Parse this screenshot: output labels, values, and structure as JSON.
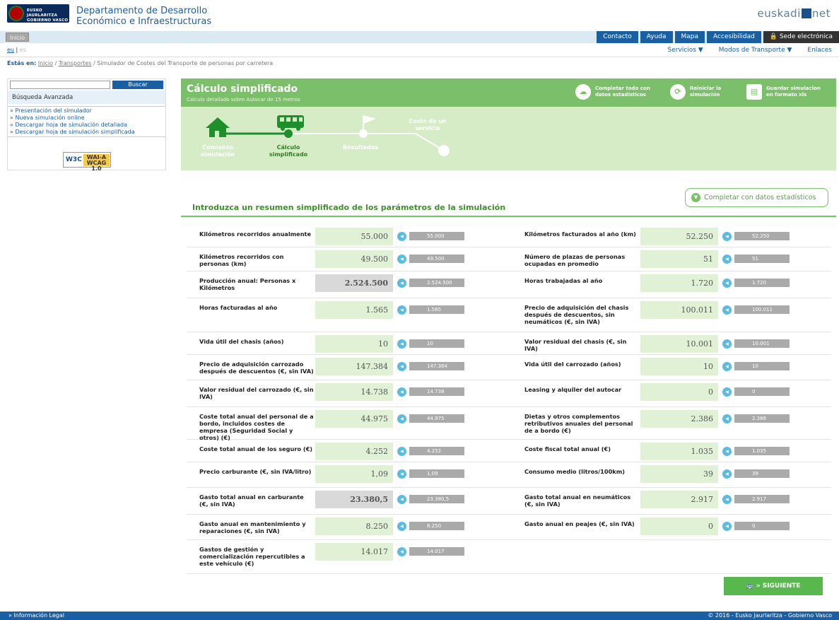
{
  "header": {
    "logo_text": "EUSKO JAURLARITZA GOBIERNO VASCO",
    "dept_line1": "Departamento de Desarrollo",
    "dept_line2": "Económico e Infraestructuras",
    "brand": "euskadi",
    "brand_suffix": "net"
  },
  "navbar": {
    "inicio": "Inicio",
    "buttons": [
      "Contacto",
      "Ayuda",
      "Mapa",
      "Accesibilidad",
      "Sede electrónica"
    ]
  },
  "lang": {
    "eu": "eu",
    "es": "es"
  },
  "menus": [
    "Servicios ▼",
    "Modos de Transporte ▼",
    "Enlaces"
  ],
  "breadcrumb": {
    "label": "Estás en:",
    "items": [
      "Inicio",
      "Transportes"
    ],
    "current": "Simulador de Costes del Transporte de personas por carretera"
  },
  "sidebar": {
    "search_button": "Buscar",
    "advanced": "Búsqueda Avanzada",
    "links": [
      "» Presentación del simulador",
      "» Nueva simulación online",
      "» Descargar hoja de simulación detallada",
      "» Descargar hoja de simulación simplificada"
    ],
    "wai_w3c": "W3C",
    "wai_level": "WAI-A",
    "wai_wcag": "WCAG 1.0"
  },
  "panel": {
    "title": "Cálculo simplificado",
    "subtitle": "Calculo detallado sobre Autocar de 15 metros",
    "actions": [
      {
        "l1": "Completar todo con",
        "l2": "datos estadísticos"
      },
      {
        "l1": "Reiniciar la",
        "l2": "simulación"
      },
      {
        "l1": "Guardar simulacion",
        "l2": "en formato xls"
      }
    ],
    "steps": [
      {
        "l1": "Comienzo",
        "l2": "simulación"
      },
      {
        "l1": "Cálculo",
        "l2": "simplificado"
      },
      {
        "l1": "Resultados",
        "l2": ""
      },
      {
        "l1": "Coste de un",
        "l2": "servicio"
      }
    ]
  },
  "form": {
    "complete_button": "Completar con datos estadísticos",
    "title": "Introduzca un resumen simplificado de los parámetros de la simulación",
    "rows": [
      {
        "left": {
          "label": "Kilómetros recorridos anualmente",
          "value": "55.000"
        },
        "right": {
          "label": "Kilómetros facturados al año (km)",
          "value": "52.250"
        }
      },
      {
        "left": {
          "label": "Kilómetros recorridos con personas (km)",
          "value": "49.500"
        },
        "right": {
          "label": "Número de plazas de personas ocupadas en promedio",
          "value": "51"
        }
      },
      {
        "left": {
          "label": "Producción anual: Personas x Kilómetros",
          "value": "2.524.500",
          "gray": true
        },
        "right": {
          "label": "Horas trabajadas al año",
          "value": "1.720"
        }
      },
      {
        "left": {
          "label": "Horas facturadas al año",
          "value": "1.565"
        },
        "right": {
          "label": "Precio de adquisición del chasis después de descuentos, sin neumáticos (€, sin IVA)",
          "value": "100.011"
        }
      },
      {
        "left": {
          "label": "Vida útil del chasis (años)",
          "value": "10"
        },
        "right": {
          "label": "Valor residual del chasis (€, sin IVA)",
          "value": "10.001"
        }
      },
      {
        "left": {
          "label": "Precio de adquisición carrozado después de descuentos (€, sin IVA)",
          "value": "147.384"
        },
        "right": {
          "label": "Vida útil del carrozado (años)",
          "value": "10"
        }
      },
      {
        "left": {
          "label": "Valor residual del carrozado (€, sin IVA)",
          "value": "14.738"
        },
        "right": {
          "label": "Leasing y alquiler del autocar",
          "value": "0"
        }
      },
      {
        "left": {
          "label": "Coste total anual del personal de a bordo, incluidos costes de empresa (Seguridad Social y otros) (€)",
          "value": "44.975"
        },
        "right": {
          "label": "Dietas y otros complementos retributivos anuales del personal de a bordo (€)",
          "value": "2.386"
        }
      },
      {
        "left": {
          "label": "Coste total anual de los seguro (€)",
          "value": "4.252"
        },
        "right": {
          "label": "Coste fiscal total anual (€)",
          "value": "1.035"
        }
      },
      {
        "left": {
          "label": "Precio carburante (€, sin IVA/litro)",
          "value": "1,09"
        },
        "right": {
          "label": "Consumo medio (litros/100km)",
          "value": "39"
        }
      },
      {
        "left": {
          "label": "Gasto total anual en carburante (€, sin IVA)",
          "value": "23.380,5",
          "gray": true
        },
        "right": {
          "label": "Gasto total anual en neumáticos (€, sin IVA)",
          "value": "2.917"
        }
      },
      {
        "left": {
          "label": "Gasto anual en mantenimiento y reparaciones (€, sin IVA)",
          "value": "8.250"
        },
        "right": {
          "label": "Gasto anual en peajes (€, sin IVA)",
          "value": "0"
        }
      },
      {
        "left": {
          "label": "Gastos de gestión y comercialización repercutibles a este vehículo (€)",
          "value": "14.017"
        }
      }
    ],
    "next_button": "» SIGUIENTE"
  },
  "footer": {
    "left": "» Información Legal",
    "right": "© 2016 - Eusko Jaurlaritza - Gobierno Vasco"
  }
}
